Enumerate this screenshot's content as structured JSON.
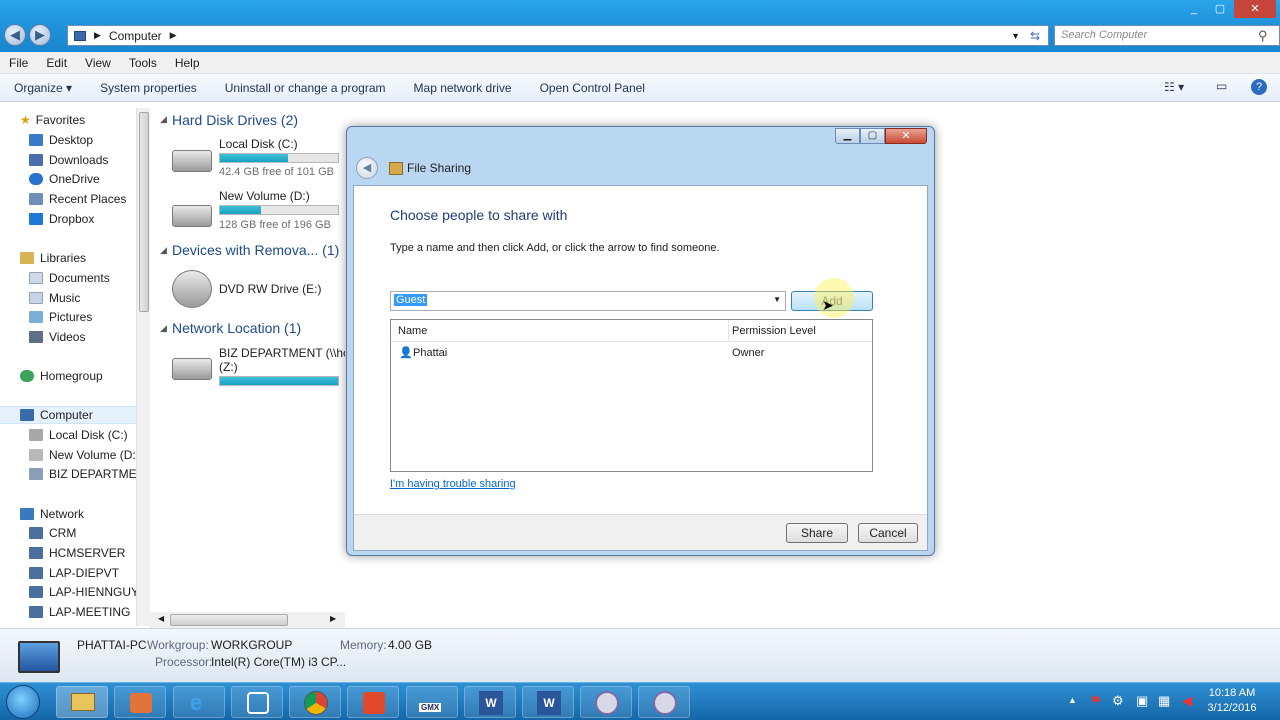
{
  "window": {
    "controls": [
      "_",
      "▢",
      "✕"
    ]
  },
  "address": {
    "path": [
      "Computer"
    ],
    "search_placeholder": "Search Computer"
  },
  "menu": [
    "File",
    "Edit",
    "View",
    "Tools",
    "Help"
  ],
  "commands": [
    "Organize ▾",
    "System properties",
    "Uninstall or change a program",
    "Map network drive",
    "Open Control Panel"
  ],
  "sidebar": {
    "favorites": {
      "label": "Favorites",
      "items": [
        "Desktop",
        "Downloads",
        "OneDrive",
        "Recent Places",
        "Dropbox"
      ]
    },
    "libraries": {
      "label": "Libraries",
      "items": [
        "Documents",
        "Music",
        "Pictures",
        "Videos"
      ]
    },
    "homegroup": "Homegroup",
    "computer": {
      "label": "Computer",
      "items": [
        "Local Disk (C:)",
        "New Volume (D:)",
        "BIZ DEPARTMENT"
      ]
    },
    "network": {
      "label": "Network",
      "items": [
        "CRM",
        "HCMSERVER",
        "LAP-DIEPVT",
        "LAP-HIENNGUYE",
        "LAP-MEETING"
      ]
    }
  },
  "content": {
    "groups": [
      "Hard Disk Drives (2)",
      "Devices with Remova... (1)",
      "Network Location (1)"
    ],
    "drives": [
      {
        "name": "Local Disk (C:)",
        "free": "42.4 GB free of 101 GB",
        "used_fraction": 0.58
      },
      {
        "name": "New Volume (D:)",
        "free": "128 GB free of 196 GB",
        "used_fraction": 0.35
      }
    ],
    "dvd": "DVD RW Drive (E:)",
    "network_drive": {
      "name": "BIZ DEPARTMENT (\\\\hcr",
      "letter": "(Z:)",
      "used_fraction": 1.0
    }
  },
  "details": {
    "computer": "PHATTAI-PC",
    "workgroup_label": "Workgroup:",
    "workgroup": "WORKGROUP",
    "memory_label": "Memory:",
    "memory": "4.00 GB",
    "processor_label": "Processor:",
    "processor": "Intel(R) Core(TM) i3 CP..."
  },
  "dialog": {
    "title": "File Sharing",
    "heading": "Choose people to share with",
    "instruction": "Type a name and then click Add, or click the arrow to find someone.",
    "input_value": "Guest",
    "add_label": "Add",
    "columns": [
      "Name",
      "Permission Level"
    ],
    "rows": [
      {
        "name": "Phattai",
        "level": "Owner"
      }
    ],
    "trouble_link": "I'm having trouble sharing",
    "share_label": "Share",
    "cancel_label": "Cancel"
  },
  "taskbar": {
    "time": "10:18 AM",
    "date": "3/12/2016",
    "gmx": "GMX"
  },
  "colors": {
    "titlebar": "#1c8fd8",
    "accent": "#1e4a8a",
    "link": "#0066cc",
    "selection": "#3399ff"
  }
}
